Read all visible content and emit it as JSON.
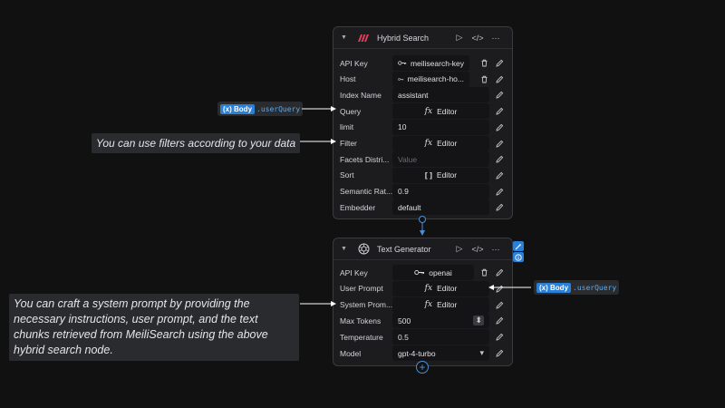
{
  "hybrid_node": {
    "title": "Hybrid Search",
    "rows": [
      {
        "label": "API Key",
        "value": "meilisearch-key"
      },
      {
        "label": "Host",
        "value": "meilisearch-ho..."
      },
      {
        "label": "Index Name",
        "value": "assistant"
      },
      {
        "label": "Query",
        "value": "Editor"
      },
      {
        "label": "limit",
        "value": "10"
      },
      {
        "label": "Filter",
        "value": "Editor"
      },
      {
        "label": "Facets Distri...",
        "value": "Value"
      },
      {
        "label": "Sort",
        "value": "Editor"
      },
      {
        "label": "Semantic Rat...",
        "value": "0.9"
      },
      {
        "label": "Embedder",
        "value": "default"
      }
    ]
  },
  "text_node": {
    "title": "Text Generator",
    "rows": [
      {
        "label": "API Key",
        "value": "openai"
      },
      {
        "label": "User Prompt",
        "value": "Editor"
      },
      {
        "label": "System Prom...",
        "value": "Editor"
      },
      {
        "label": "Max Tokens",
        "value": "500"
      },
      {
        "label": "Temperature",
        "value": "0.5"
      },
      {
        "label": "Model",
        "value": "gpt-4-turbo"
      }
    ]
  },
  "annotations": {
    "filters": "You can use filters according to your data",
    "prompt": "You can craft a system prompt by providing the necessary instructions, user prompt, and the text chunks retrieved from MeiliSearch using the above hybrid search node."
  },
  "variable": {
    "chip_icon": "(x)",
    "chip_label": "Body",
    "property": ".userQuery"
  },
  "glyphs": {
    "play": "▷",
    "code": "</>",
    "more": "···",
    "fx": "fx",
    "array": "[ ]",
    "chevron": "▾",
    "stepper": "⬍",
    "add": "+"
  },
  "colors": {
    "accent": "#2a7fd6",
    "hybrid_logo": "#e0415a",
    "connector": "#4a90d9"
  }
}
